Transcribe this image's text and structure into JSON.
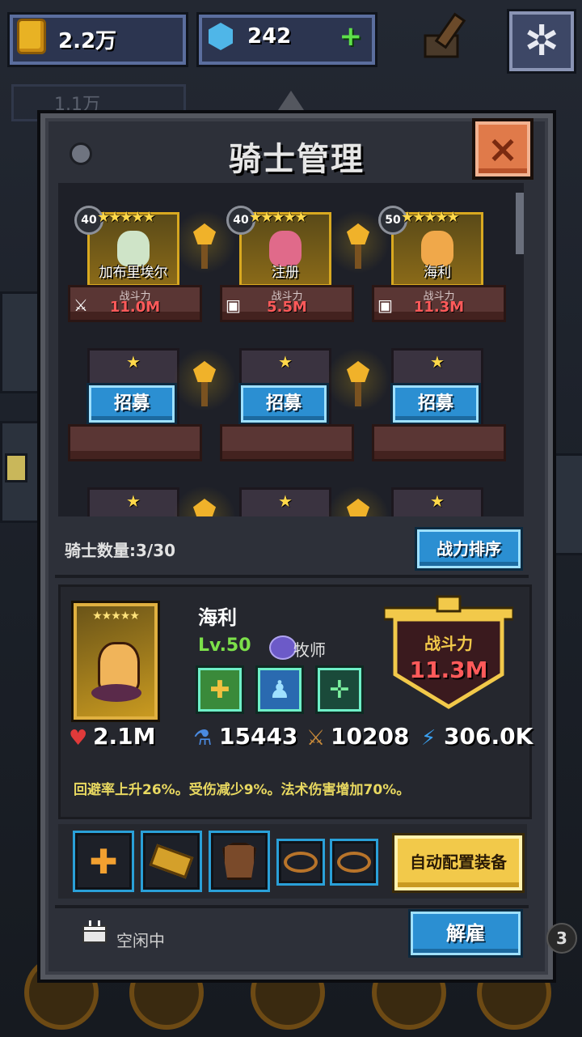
{
  "topbar": {
    "gold": "2.2万",
    "gems": "242",
    "gems_add": "+",
    "sub_gold": "1.1万"
  },
  "panel": {
    "title": "骑士管理",
    "close": "×"
  },
  "heroes": [
    {
      "level": "40",
      "stars": "★★★★★",
      "name": "加布里埃尔",
      "power_label": "战斗力",
      "power": "11.0M"
    },
    {
      "level": "40",
      "stars": "★★★★★",
      "name": "注册",
      "power_label": "战斗力",
      "power": "5.5M"
    },
    {
      "level": "50",
      "stars": "★★★★★",
      "name": "海利",
      "power_label": "战斗力",
      "power": "11.3M"
    }
  ],
  "empty_slots": [
    {
      "star": "★",
      "button": "招募"
    },
    {
      "star": "★",
      "button": "招募"
    },
    {
      "star": "★",
      "button": "招募"
    }
  ],
  "empty_slots_row3": [
    {
      "star": "★"
    },
    {
      "star": "★"
    },
    {
      "star": "★"
    }
  ],
  "knight_count": "骑士数量:3/30",
  "sort_button": "战力排序",
  "detail": {
    "stars": "★★★★★",
    "name": "海利",
    "level": "Lv.50",
    "class": "牧师",
    "power_label": "战斗力",
    "power": "11.3M",
    "hp": "2.1M",
    "mana": "15443",
    "attack": "10208",
    "speed": "306.0K",
    "description": "回避率上升26%。受伤减少9%。法术伤害增加70%。"
  },
  "equip": {
    "auto_button": "自动配置装备"
  },
  "status": "空闲中",
  "dismiss_button": "解雇",
  "corner_badge": "3",
  "colors": {
    "panel": "#2d3039",
    "accent_blue": "#2b8fd2",
    "power_red": "#ff5a5a",
    "gold": "#e0b040"
  }
}
